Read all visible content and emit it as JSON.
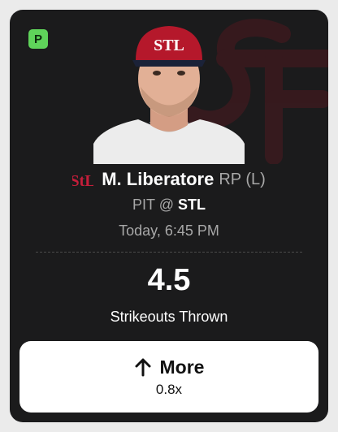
{
  "card": {
    "badge": "P",
    "player": {
      "name": "M. Liberatore",
      "position": "RP (L)",
      "team_logo_icon": "cardinals-stl-icon"
    },
    "matchup": {
      "away": "PIT",
      "separator": "@",
      "home": "STL"
    },
    "game_time": "Today, 6:45 PM",
    "line": "4.5",
    "stat": "Strikeouts Thrown",
    "more_button": {
      "label": "More",
      "multiplier": "0.8x",
      "icon": "arrow-up-icon"
    }
  },
  "colors": {
    "card_bg": "#1b1b1c",
    "badge_green": "#5fd35a",
    "team_red": "#c41e3a",
    "muted_text": "#a8a8a8"
  }
}
